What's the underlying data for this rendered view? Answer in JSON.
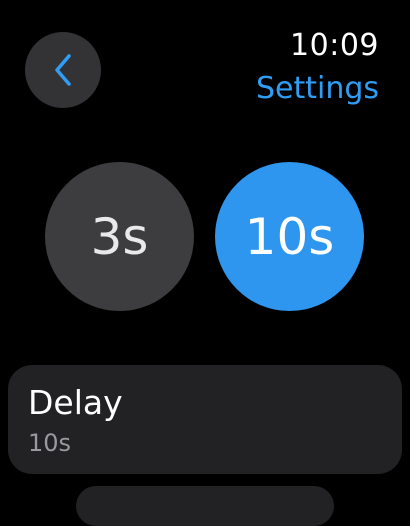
{
  "status_bar": {
    "time": "10:09"
  },
  "header": {
    "back_icon": "chevron-left-icon",
    "title": "Settings"
  },
  "options": [
    {
      "label": "3s",
      "selected": false
    },
    {
      "label": "10s",
      "selected": true
    }
  ],
  "delay": {
    "label": "Delay",
    "value": "10s"
  },
  "colors": {
    "accent": "#2e96ee",
    "title": "#2f9df4",
    "button_bg": "#333336",
    "option_bg": "#3d3d3f",
    "row_bg": "#222224",
    "secondary_text": "#9a9a9e"
  }
}
